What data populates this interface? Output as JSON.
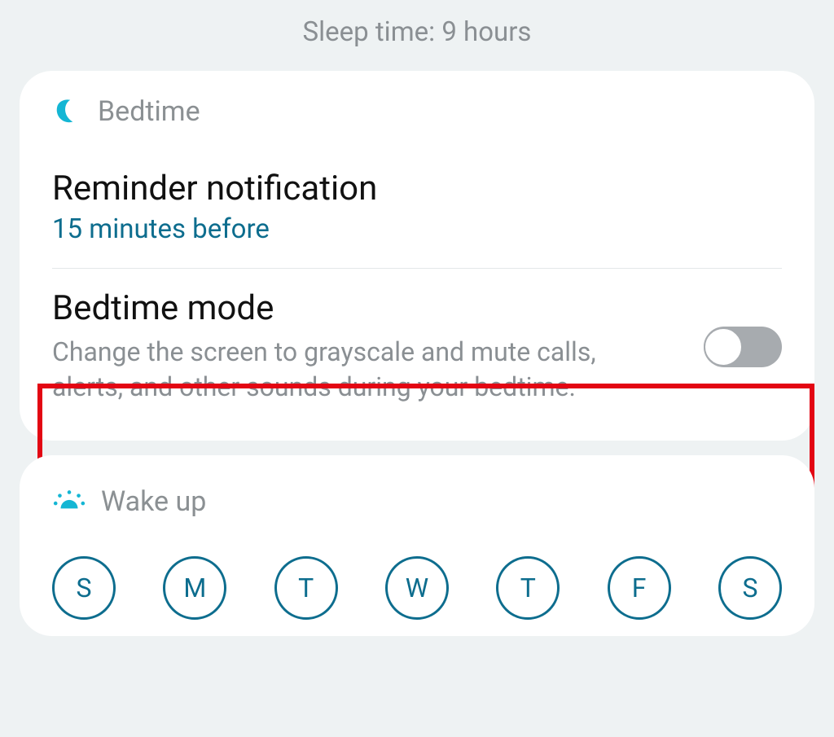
{
  "header": {
    "sleep_time": "Sleep time: 9 hours"
  },
  "bedtime_card": {
    "title": "Bedtime",
    "reminder": {
      "title": "Reminder notification",
      "value": "15 minutes before"
    },
    "bedtime_mode": {
      "title": "Bedtime mode",
      "description": "Change the screen to grayscale and mute calls, alerts, and other sounds during your bedtime.",
      "enabled": false
    }
  },
  "wakeup_card": {
    "title": "Wake up",
    "days": [
      "S",
      "M",
      "T",
      "W",
      "T",
      "F",
      "S"
    ]
  },
  "colors": {
    "accent": "#14b6d4",
    "teal_text": "#0d6d8e",
    "highlight": "#e30613"
  }
}
